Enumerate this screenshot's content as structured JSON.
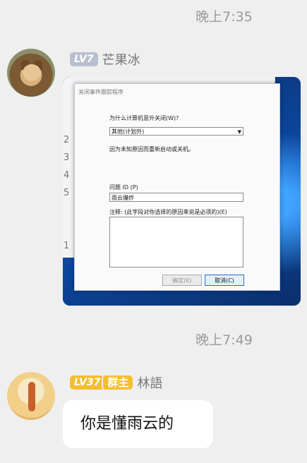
{
  "chat": {
    "timestamp1": "晚上7:35",
    "timestamp2": "晚上7:49"
  },
  "msg1": {
    "level": "LV7",
    "nickname": "芒果冰",
    "screenshot": {
      "dialog_title": "关闭事件跟踪程序",
      "question": "为什么计算机意外关闭(W)?",
      "select_value": "其他(计划外)",
      "description": "因为未知原因而重新启动或关机。",
      "problem_id_label": "问题 ID (P)",
      "problem_id_value": "雨云爆炸",
      "comment_label": "注释: (此字段对你选择的原因来说是必须的)(E)",
      "ok_button": "确定(K)",
      "cancel_button": "取消(C)",
      "bg_numbers": [
        "2",
        "3",
        "4",
        "5",
        "1"
      ]
    }
  },
  "msg2": {
    "level": "LV37",
    "role_badge": "群主",
    "nickname": "林語",
    "text": "你是懂雨云的"
  }
}
